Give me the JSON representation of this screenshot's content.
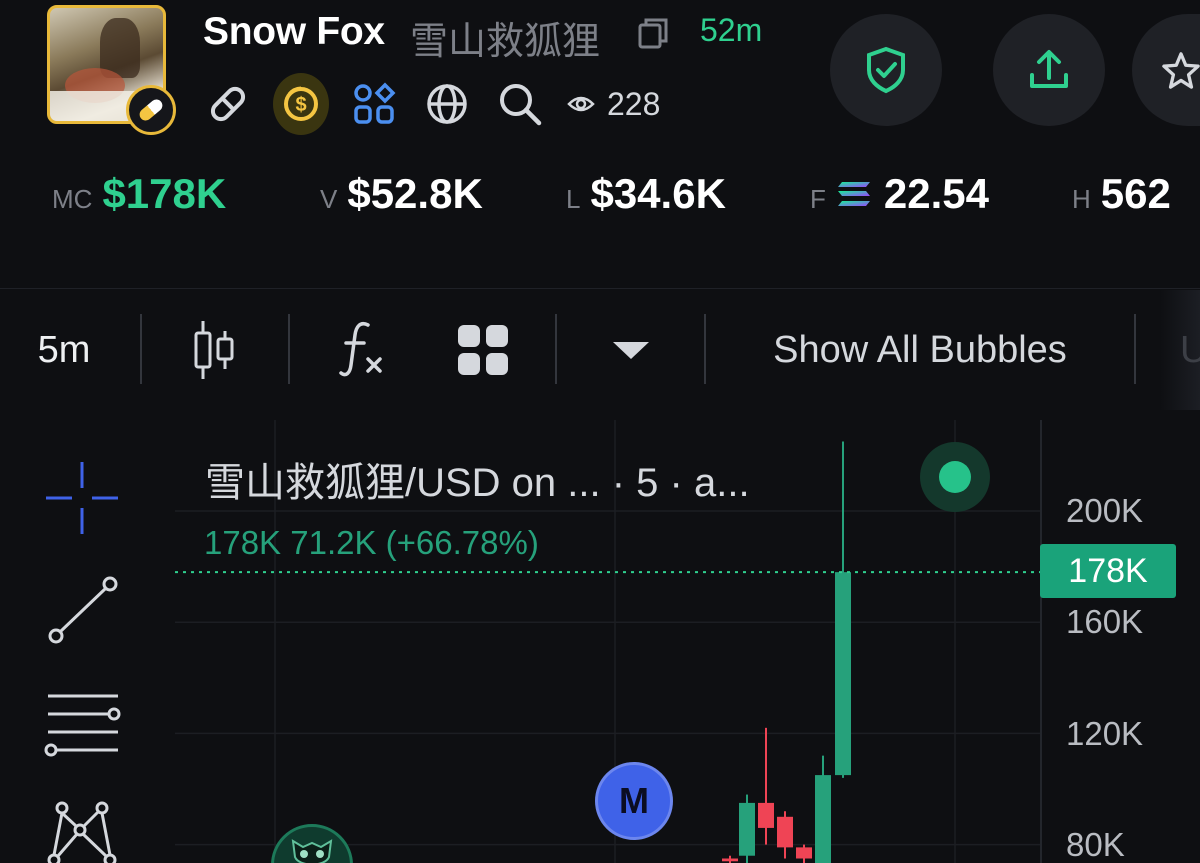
{
  "token": {
    "name": "Snow Fox",
    "name_cn": "雪山救狐狸",
    "age": "52m",
    "views": "228"
  },
  "header_icons": [
    "pill-icon",
    "link-icon",
    "dollar-coin-icon",
    "grid-apps-icon",
    "globe-icon",
    "search-icon",
    "eye-icon",
    "copy-icon"
  ],
  "actions": [
    "shield-check-icon",
    "share-upload-icon",
    "star-icon"
  ],
  "stats": {
    "mc": {
      "label": "MC",
      "value": "$178K"
    },
    "v": {
      "label": "V",
      "value": "$52.8K"
    },
    "l": {
      "label": "L",
      "value": "$34.6K"
    },
    "f": {
      "label": "F",
      "value": "22.54"
    },
    "h": {
      "label": "H",
      "value": "562"
    }
  },
  "toolbar": {
    "interval": "5m",
    "bubbles": "Show All Bubbles",
    "cut_text": "U"
  },
  "chart_header": {
    "title_cn": "雪山救狐狸",
    "title_rest": "/USD on ...  · 5 · a...",
    "ohlc": "178K  71.2K (+66.78%)"
  },
  "chart_data": {
    "type": "candlestick",
    "current_price_label": "178K",
    "y_axis_ticks": [
      "200K",
      "160K",
      "120K",
      "80K"
    ],
    "markers": [
      {
        "label": "M"
      }
    ]
  },
  "colors": {
    "green": "#26a17b",
    "red": "#ef4455",
    "accent_green": "#2fd08f",
    "gold": "#e8b93a",
    "blue_marker": "#3f62e8"
  }
}
